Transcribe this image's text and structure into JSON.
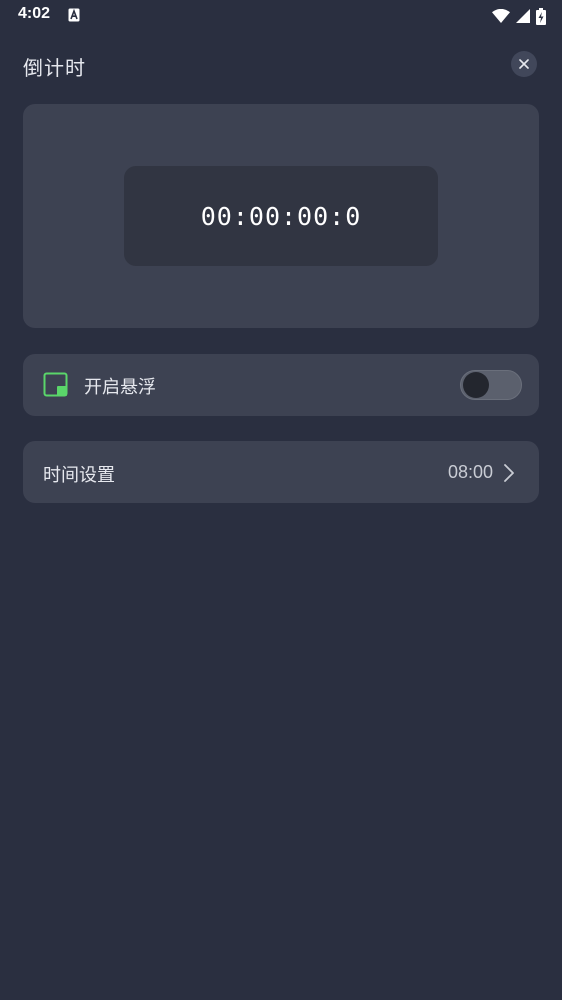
{
  "status_bar": {
    "time": "4:02"
  },
  "header": {
    "title": "倒计时"
  },
  "timer": {
    "display": "00:00:00:0"
  },
  "floating": {
    "label": "开启悬浮",
    "enabled": false
  },
  "time_setting": {
    "label": "时间设置",
    "value": "08:00"
  },
  "colors": {
    "background": "#2a2f40",
    "card": "#3d4252",
    "timer_box": "#313542",
    "accent_green": "#5ad66a",
    "toggle_track_off": "#5b606d"
  },
  "icons": {
    "status_left": "a-notification-icon",
    "wifi": "wifi-icon",
    "signal": "signal-icon",
    "battery": "battery-charging-icon",
    "close": "close-icon",
    "floating": "picture-in-picture-icon",
    "chevron": "chevron-right-icon"
  }
}
